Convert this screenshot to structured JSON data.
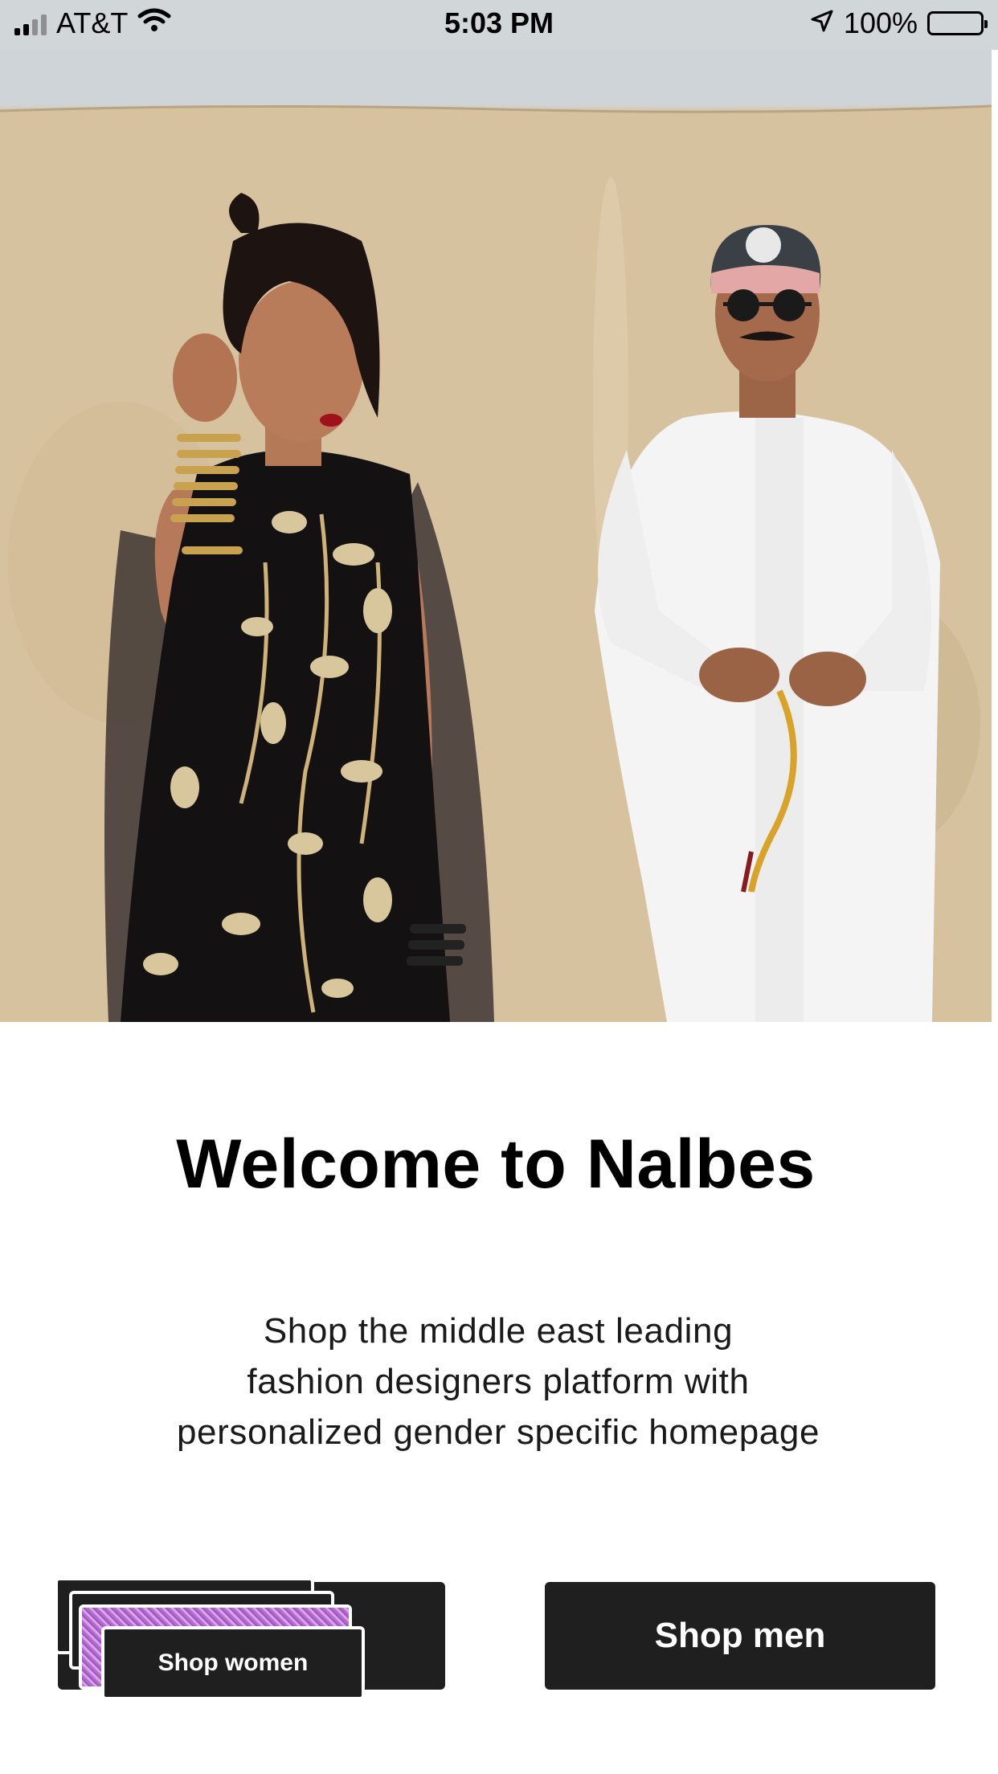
{
  "status_bar": {
    "carrier": "AT&T",
    "time": "5:03 PM",
    "battery_percent": "100%",
    "battery_level": 1.0,
    "battery_color": "#f4c635",
    "icons": [
      "signal-icon",
      "wifi-icon",
      "location-arrow-icon",
      "battery-icon"
    ]
  },
  "hero": {
    "image": "fashion-models-photo"
  },
  "welcome": {
    "title": "Welcome to Nalbes",
    "subtitle_lines": [
      "Shop the middle east leading",
      "fashion designers platform with",
      "personalized gender specific homepage"
    ]
  },
  "buttons": {
    "shop_women": "Shop women",
    "shop_men": "Shop men",
    "button_color": "#1f1f1f"
  }
}
